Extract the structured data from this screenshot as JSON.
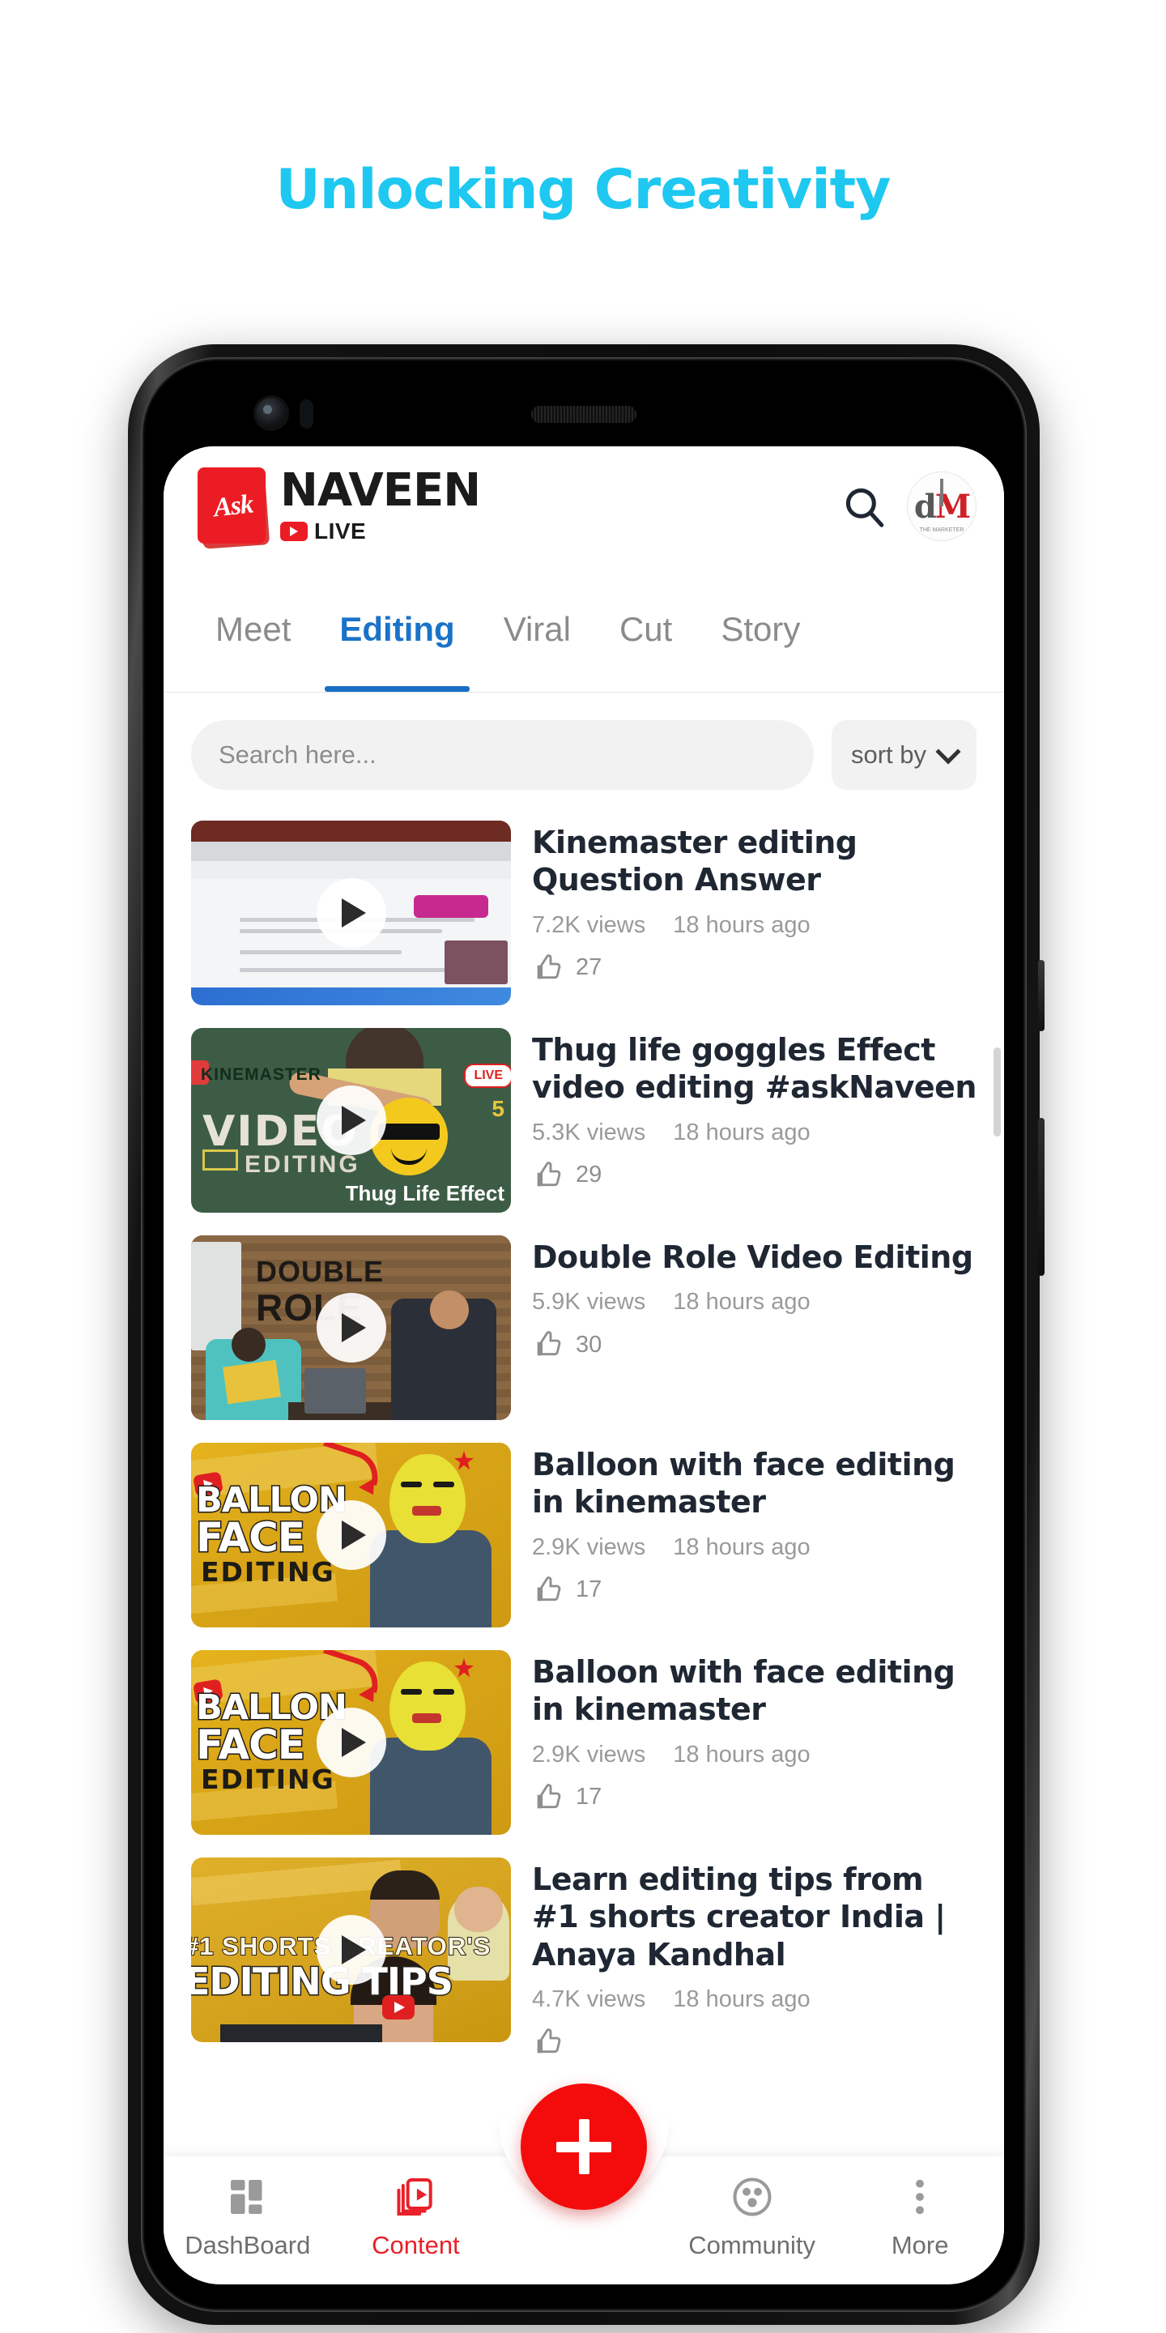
{
  "page": {
    "title": "Unlocking Creativity",
    "accent_color": "#1EC8F0"
  },
  "app": {
    "header": {
      "logo_badge": "Ask",
      "brand_name": "NAVEEN",
      "brand_sub": "LIVE",
      "search_icon": "search-icon",
      "avatar_text_d": "d",
      "avatar_text_m": "M",
      "avatar_tag": "THE MARKETER"
    },
    "tabs": [
      {
        "label": "Meet",
        "active": false
      },
      {
        "label": "Editing",
        "active": true
      },
      {
        "label": "Viral",
        "active": false
      },
      {
        "label": "Cut",
        "active": false
      },
      {
        "label": "Story",
        "active": false
      }
    ],
    "search": {
      "placeholder": "Search here...",
      "value": ""
    },
    "sort": {
      "label": "sort by",
      "icon": "chevron-down-icon"
    },
    "videos": [
      {
        "title": "Kinemaster editing Question Answer",
        "views": "7.2K views",
        "age": "18 hours ago",
        "likes": "27",
        "thumb_style": "browser",
        "thumb_text": ""
      },
      {
        "title": "Thug life goggles Effect video editing  #askNaveen",
        "views": "5.3K views",
        "age": "18 hours ago",
        "likes": "29",
        "thumb_style": "kinemaster",
        "thumb_text": "KINEMASTER VIDEO EDITING Thug Life Effect LIVE 5"
      },
      {
        "title": "Double Role Video Editing",
        "views": "5.9K views",
        "age": "18 hours ago",
        "likes": "30",
        "thumb_style": "double-role",
        "thumb_text": "DOUBLE ROLE"
      },
      {
        "title": "Balloon with face editing in kinemaster",
        "views": "2.9K views",
        "age": "18 hours ago",
        "likes": "17",
        "thumb_style": "balloon",
        "thumb_text": "BALLON FACE EDITING"
      },
      {
        "title": "Balloon with face editing in kinemaster",
        "views": "2.9K views",
        "age": "18 hours ago",
        "likes": "17",
        "thumb_style": "balloon",
        "thumb_text": "BALLON FACE EDITING"
      },
      {
        "title": "Learn editing tips from #1 shorts creator India | Anaya Kandhal",
        "views": "4.7K views",
        "age": "18 hours ago",
        "likes": "",
        "thumb_style": "shorts",
        "thumb_text": "#1 SHORTS CREATOR'S EDITING TIPS"
      }
    ],
    "thumb_labels": {
      "kinemaster_brand": "KINEMASTER",
      "kinemaster_live": "LIVE",
      "kinemaster_num": "5",
      "kinemaster_video": "VIDEO",
      "kinemaster_editing": "EDITING",
      "kinemaster_effect": "Thug Life Effect",
      "double_l1": "DOUBLE",
      "double_l2": "ROLE",
      "balloon_l1": "BALLON",
      "balloon_l2": "FACE",
      "balloon_l3": "EDITING",
      "shorts_l1": "#1  SHORTS CREATOR'S",
      "shorts_l2": "EDITING TIPS"
    },
    "fab": {
      "icon": "plus-icon",
      "label": "Create"
    },
    "bottom_nav": [
      {
        "label": "DashBoard",
        "icon": "dashboard-grid-icon",
        "active": false
      },
      {
        "label": "Content",
        "icon": "content-video-icon",
        "active": true
      },
      {
        "label": "Community",
        "icon": "community-people-icon",
        "active": false
      },
      {
        "label": "More",
        "icon": "more-dots-icon",
        "active": false
      }
    ]
  }
}
